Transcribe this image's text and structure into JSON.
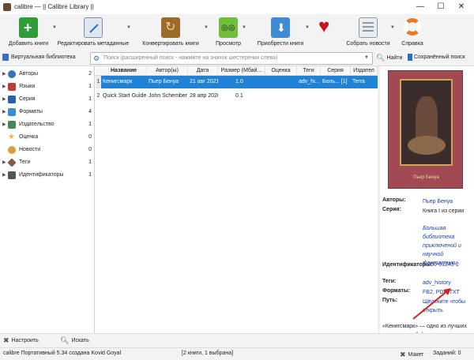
{
  "window": {
    "title": "calibre — || Calibre Library ||",
    "minimize": "—",
    "maximize": "☐",
    "close": "✕"
  },
  "toolbar": [
    {
      "label": "Добавить книги",
      "icon": "add-book-icon",
      "color": "#2f9e3a",
      "dropdown": true
    },
    {
      "label": "Редактировать метаданные",
      "icon": "edit-metadata-icon",
      "color": "#7a8fa8",
      "dropdown": true
    },
    {
      "label": "Конвертировать книги",
      "icon": "convert-books-icon",
      "color": "#9c6a2a",
      "dropdown": true
    },
    {
      "label": "Просмотр",
      "icon": "view-icon",
      "color": "#6fbf3a",
      "dropdown": true
    },
    {
      "label": "Приобрести книги",
      "icon": "get-books-icon",
      "color": "#3f8bd6",
      "dropdown": true
    },
    {
      "label": "",
      "icon": "heart-icon",
      "color": "#c4161c",
      "dropdown": false
    },
    {
      "label": "Собрать новости",
      "icon": "fetch-news-icon",
      "color": "#8a9aa8",
      "dropdown": true
    },
    {
      "label": "Справка",
      "icon": "help-icon",
      "color": "#e8792a",
      "dropdown": false
    }
  ],
  "search": {
    "virtual_library": "Виртуальная библиотека",
    "placeholder": "Поиск (расширенный поиск - нажмите на значок шестеренки слева)",
    "find": "Найти",
    "saved": "Сохранённый поиск"
  },
  "tags": [
    {
      "label": "Авторы",
      "count": "2",
      "icon": "authors-icon",
      "color": "#3a6fc4"
    },
    {
      "label": "Языки",
      "count": "1",
      "icon": "languages-icon",
      "color": "#c43a3a"
    },
    {
      "label": "Серия",
      "count": "1",
      "icon": "series-icon",
      "color": "#2a5fb0"
    },
    {
      "label": "Форматы",
      "count": "4",
      "icon": "formats-icon",
      "color": "#3a8bd6"
    },
    {
      "label": "Издательство",
      "count": "1",
      "icon": "publisher-icon",
      "color": "#3a8a5a"
    },
    {
      "label": "Оценка",
      "count": "0",
      "icon": "rating-icon",
      "color": "#e8b82a"
    },
    {
      "label": "Новости",
      "count": "0",
      "icon": "news-icon",
      "color": "#d6a13a"
    },
    {
      "label": "Теги",
      "count": "1",
      "icon": "tags-icon",
      "color": "#8a5a3a"
    },
    {
      "label": "Идентификаторы",
      "count": "1",
      "icon": "identifiers-icon",
      "color": "#555555"
    }
  ],
  "columns": [
    "Название",
    "Автор(ы)",
    "Дата",
    "Размер (Мбай...",
    "Оценка",
    "Теги",
    "Серия",
    "Издател"
  ],
  "books": [
    {
      "num": "1",
      "title": "Кенигсмарк",
      "author": "Пьер Бенуа",
      "date": "21 авг 2021",
      "size": "1.0",
      "rating": "",
      "tags": "adv_hi...",
      "series": "Боль... [1]",
      "publisher": "Terra"
    },
    {
      "num": "2",
      "title": "Quick Start Guide",
      "author": "John Schember",
      "date": "28 апр 2020",
      "size": "0.1",
      "rating": "",
      "tags": "",
      "series": "",
      "publisher": ""
    }
  ],
  "cover": {
    "author": "Пьер Бенуа"
  },
  "details": {
    "authors_label": "Авторы:",
    "authors_value": "Пьер Бенуа",
    "series_label": "Серия:",
    "series_value_1": "Книга I из серии",
    "series_value_2": "Большая библиотека приключений и научной фантастики",
    "identifiers_label": "Идентификаторы:",
    "identifiers_value": "5-300-01243-2",
    "tags_label": "Теги:",
    "tags_value": "adv_history",
    "formats_label": "Форматы:",
    "formats_value": "FB2, PDF, TXT",
    "path_label": "Путь:",
    "path_value": "Щёлкните чтобы открыть",
    "description": "«Кенигсмарк» — одно из лучших произведений французского мастера"
  },
  "bottom": {
    "configure": "Настроить",
    "find": "Искать",
    "layout": "Макет",
    "jobs": "Заданий: 0"
  },
  "status": {
    "left": "calibre Портативный 5.34 создана Kovid Goyal",
    "count": "[2 книги, 1 выбрана]"
  }
}
